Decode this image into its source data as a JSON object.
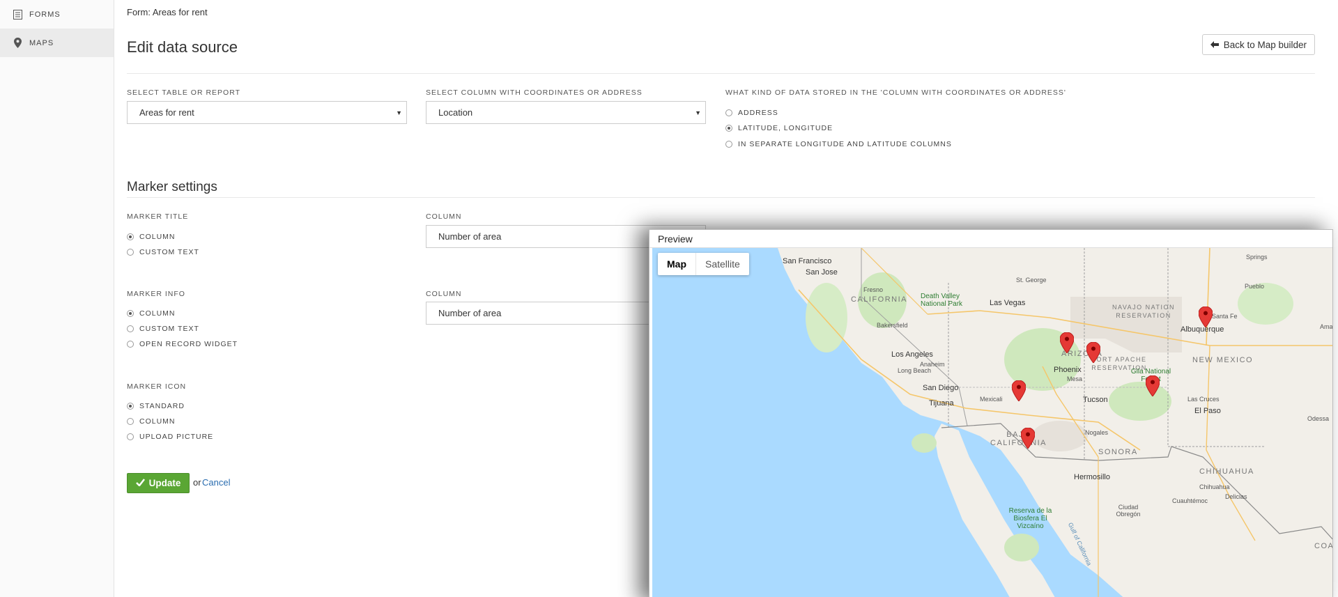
{
  "sidebar": {
    "items": [
      {
        "label": "FORMS",
        "icon": "forms-icon",
        "active": false
      },
      {
        "label": "MAPS",
        "icon": "map-pin-icon",
        "active": true
      }
    ]
  },
  "header": {
    "breadcrumb": "Form: Areas for rent",
    "title": "Edit data source",
    "back_button": "Back to Map builder"
  },
  "source": {
    "table_label": "SELECT TABLE OR REPORT",
    "table_value": "Areas for rent",
    "column_label": "SELECT COLUMN WITH COORDINATES OR ADDRESS",
    "column_value": "Location",
    "kind_label": "WHAT KIND OF DATA STORED IN THE 'COLUMN WITH COORDINATES OR ADDRESS'",
    "kind_options": [
      "ADDRESS",
      "LATITUDE, LONGITUDE",
      "IN SEPARATE LONGITUDE AND LATITUDE COLUMNS"
    ],
    "kind_selected": "LATITUDE, LONGITUDE"
  },
  "marker": {
    "section_title": "Marker settings",
    "title_label": "MARKER TITLE",
    "title_options": [
      "COLUMN",
      "CUSTOM TEXT"
    ],
    "title_column_label": "COLUMN",
    "title_column_value": "Number of area",
    "info_label": "MARKER INFO",
    "info_options": [
      "COLUMN",
      "CUSTOM TEXT",
      "OPEN RECORD WIDGET"
    ],
    "info_column_label": "COLUMN",
    "info_column_value": "Number of area",
    "icon_label": "MARKER ICON",
    "icon_options": [
      "STANDARD",
      "COLUMN",
      "UPLOAD PICTURE"
    ]
  },
  "actions": {
    "update": "Update",
    "or": "or",
    "cancel": "Cancel"
  },
  "preview": {
    "title": "Preview",
    "map_type_map": "Map",
    "map_type_satellite": "Satellite",
    "labels": {
      "san_francisco": "San Francisco",
      "san_jose": "San Jose",
      "fresno": "Fresno",
      "california": "CALIFORNIA",
      "death_valley": "Death Valley National Park",
      "las_vegas": "Las Vegas",
      "st_george": "St. George",
      "bakersfield": "Bakersfield",
      "los_angeles": "Los Angeles",
      "anaheim": "Anaheim",
      "long_beach": "Long Beach",
      "san_diego": "San Diego",
      "tijuana": "Tijuana",
      "mexicali": "Mexicali",
      "baja_california": "BAJA CALIFORNIA",
      "arizona": "ARIZONA",
      "phoenix": "Phoenix",
      "mesa": "Mesa",
      "tucson": "Tucson",
      "nogales": "Nogales",
      "navajo": "NAVAJO NATION RESERVATION",
      "fort_apache": "FORT APACHE RESERVATION",
      "gila": "Gila National Forest",
      "new_mexico": "NEW MEXICO",
      "santa_fe": "Santa Fe",
      "albuquerque": "Albuquerque",
      "las_cruces": "Las Cruces",
      "el_paso": "El Paso",
      "odessa": "Odessa",
      "sonora": "SONORA",
      "hermosillo": "Hermosillo",
      "chihuahua": "CHIHUAHUA",
      "chihuahua_city": "Chihuahua",
      "delicias": "Delicias",
      "cuauhtemoc": "Cuauhtémoc",
      "ciudad_obregon": "Ciudad Obregón",
      "biosfera": "Reserva de la Biosfera El Vizcaíno",
      "springs": "Springs",
      "pueblo": "Pueblo",
      "amarillo": "Amar",
      "coahuila": "COAH",
      "gulf": "Gulf of California"
    }
  },
  "colors": {
    "accent_green": "#5aa634",
    "link_blue": "#2a6db0",
    "water": "#aadaff",
    "land": "#f2efe9",
    "park": "#c8e6b4",
    "marker_red": "#e53935"
  }
}
